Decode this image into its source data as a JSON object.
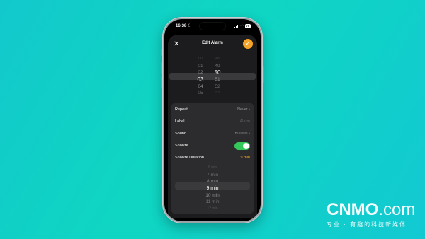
{
  "status_bar": {
    "time": "16:38",
    "battery": "79"
  },
  "header": {
    "title": "Edit Alarm"
  },
  "time_picker": {
    "hours": [
      "00",
      "01",
      "02",
      "03",
      "04",
      "05",
      "06"
    ],
    "minutes": [
      "48",
      "49",
      "50",
      "51",
      "52",
      "53"
    ],
    "selected_hour": "03",
    "selected_minute": "50"
  },
  "settings": {
    "repeat": {
      "label": "Repeat",
      "value": "Never"
    },
    "label": {
      "label": "Label",
      "placeholder": "Alarm"
    },
    "sound": {
      "label": "Sound",
      "value": "Bulletin"
    },
    "snooze": {
      "label": "Snooze",
      "enabled": true
    },
    "snooze_duration": {
      "label": "Snooze Duration",
      "value": "9 min"
    }
  },
  "snooze_picker": {
    "options": [
      "6 min",
      "7 min",
      "8 min",
      "9 min",
      "10 min",
      "11 min",
      "12 min"
    ],
    "selected": "9 min"
  },
  "watermark": {
    "brand": "CNMO",
    "suffix": ".com",
    "tagline": "专业 · 有趣的科技新媒体"
  },
  "colors": {
    "accent": "#f4a429",
    "toggle_on": "#34c759",
    "background": "#12c8cc"
  }
}
